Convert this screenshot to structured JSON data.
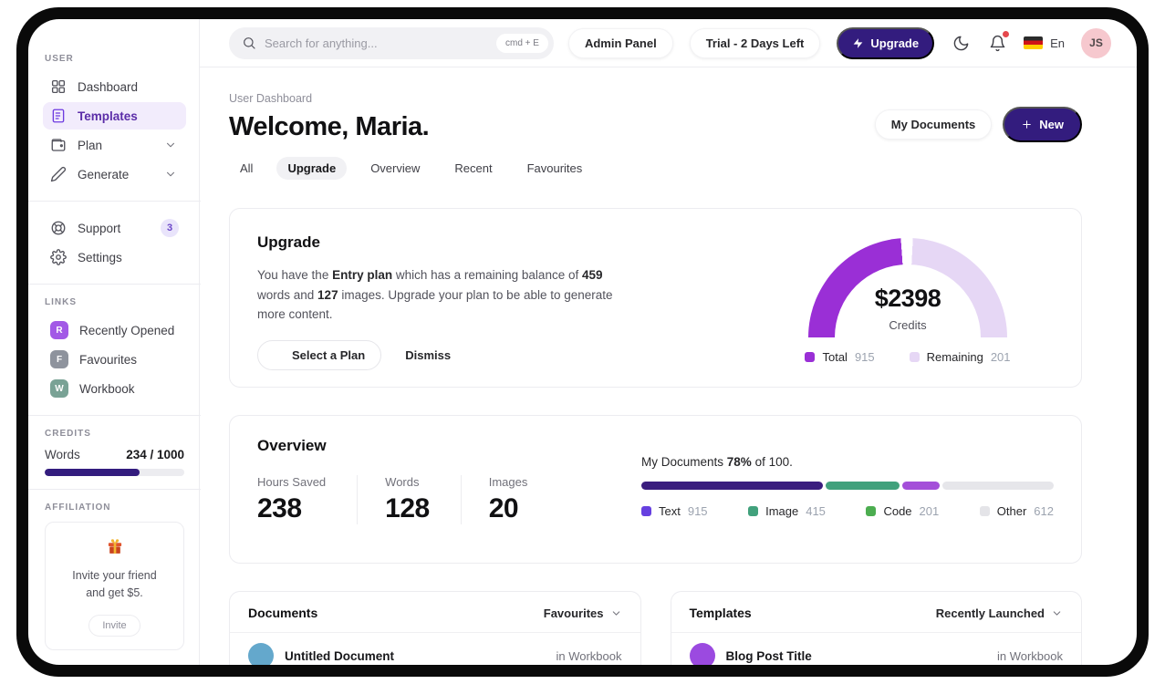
{
  "colors": {
    "accent_deep_purple": "#331c7e",
    "sidebar_active_bg": "#f2ecfc",
    "sidebar_active_text": "#5b2da8",
    "notification_dot": "#e5484d",
    "avatar_bg": "#f6c8ce"
  },
  "topbar": {
    "search_placeholder": "Search for anything...",
    "search_shortcut": "cmd + E",
    "admin_panel": "Admin Panel",
    "trial": "Trial - 2 Days Left",
    "upgrade": "Upgrade",
    "language": "En",
    "avatar_initials": "JS"
  },
  "sidebar": {
    "sections": {
      "user": "User",
      "links": "Links",
      "credits": "Credits",
      "affiliation": "Affiliation"
    },
    "nav": [
      {
        "label": "Dashboard",
        "active": false,
        "expandable": false
      },
      {
        "label": "Templates",
        "active": true,
        "expandable": false
      },
      {
        "label": "Plan",
        "active": false,
        "expandable": true
      },
      {
        "label": "Generate",
        "active": false,
        "expandable": true
      }
    ],
    "support": {
      "label": "Support",
      "badge": "3"
    },
    "settings": {
      "label": "Settings"
    },
    "links": [
      {
        "letter": "R",
        "label": "Recently Opened",
        "color": "#a259e6"
      },
      {
        "letter": "F",
        "label": "Favourites",
        "color": "#8e939d"
      },
      {
        "letter": "W",
        "label": "Workbook",
        "color": "#79a295"
      }
    ],
    "credits": {
      "label": "Words",
      "value": "234 / 1000",
      "percent": 68
    },
    "affiliation": {
      "line1": "Invite your friend",
      "line2": "and get $5.",
      "button": "Invite"
    }
  },
  "header": {
    "breadcrumb": "User Dashboard",
    "title": "Welcome, Maria.",
    "my_documents": "My Documents",
    "new_button": "New"
  },
  "tabs": {
    "items": [
      "All",
      "Upgrade",
      "Overview",
      "Recent",
      "Favourites"
    ],
    "active": "Upgrade"
  },
  "upgrade_card": {
    "title": "Upgrade",
    "body": {
      "p1": "You have the ",
      "b1": "Entry plan",
      "p2": " which has a remaining balance of ",
      "b2": "459",
      "p3": " words and ",
      "b3": "127",
      "p4": " images. Upgrade your plan to be able to generate more content."
    },
    "select_plan": "Select a Plan",
    "dismiss": "Dismiss",
    "gauge": {
      "type": "gauge-donut",
      "center_value": "$2398",
      "center_label": "Credits",
      "total_label": "Total",
      "total_value": "915",
      "remaining_label": "Remaining",
      "remaining_value": "201",
      "total_color": "#9a2fd6",
      "remaining_color": "#e6d7f5",
      "total_deg": 86,
      "gap_deg": 7
    }
  },
  "overview_card": {
    "title": "Overview",
    "stats": [
      {
        "label": "Hours Saved",
        "value": "238"
      },
      {
        "label": "Words",
        "value": "128"
      },
      {
        "label": "Images",
        "value": "20"
      }
    ],
    "docs_line": {
      "p1": "My Documents ",
      "b1": "78%",
      "p2": " of 100."
    },
    "bar": {
      "type": "stacked-bar",
      "segments": [
        {
          "color": "#3a1d7e",
          "pct": 44
        },
        {
          "color": "#41a17c",
          "pct": 18
        },
        {
          "color": "#a44fd9",
          "pct": 9
        },
        {
          "color": "#e6e6ea",
          "pct": null
        }
      ]
    },
    "legend": [
      {
        "label": "Text",
        "value": "915",
        "color": "#6640e0"
      },
      {
        "label": "Image",
        "value": "415",
        "color": "#41a17c"
      },
      {
        "label": "Code",
        "value": "201",
        "color": "#4cad50"
      },
      {
        "label": "Other",
        "value": "612",
        "color": "#e4e4e8"
      }
    ]
  },
  "documents_card": {
    "title": "Documents",
    "filter": "Favourites",
    "rows": [
      {
        "title": "Untitled Document",
        "location": "in Workbook",
        "avatar_color": "#64a8cc"
      }
    ]
  },
  "templates_card": {
    "title": "Templates",
    "filter": "Recently Launched",
    "rows": [
      {
        "title": "Blog Post Title",
        "location": "in Workbook",
        "avatar_color": "#9b4ae0"
      }
    ]
  }
}
